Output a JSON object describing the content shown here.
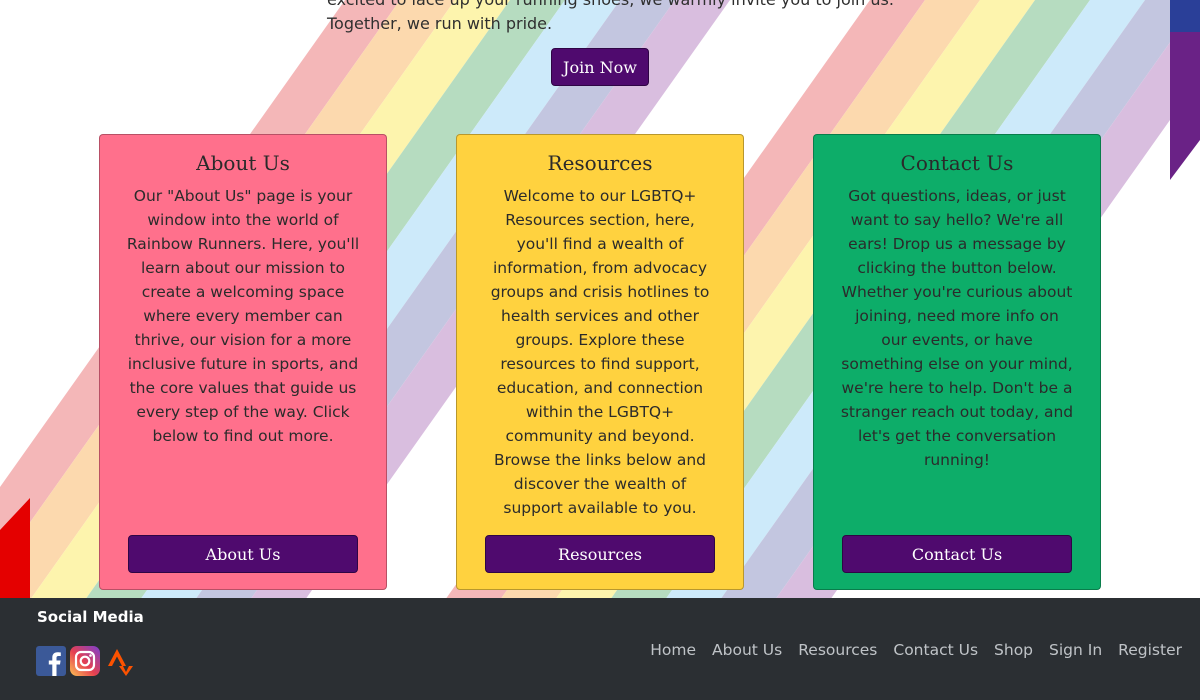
{
  "intro": {
    "line1": "excited to lace up your running shoes, we warmly invite you to join us.",
    "line2": "Together, we run with pride.",
    "join_label": "Join Now"
  },
  "colors": {
    "button": "#4f0a6e",
    "about_card": "#ff708c",
    "resources_card": "#ffd23f",
    "contact_card": "#0dad69",
    "footer": "#2b2f33"
  },
  "cards": [
    {
      "title": "About Us",
      "body": "Our \"About Us\" page is your window into the world of Rainbow Runners. Here, you'll learn about our mission to create a welcoming space where every member can thrive, our vision for a more inclusive future in sports, and the core values that guide us every step of the way. Click below to find out more.",
      "button": "About Us"
    },
    {
      "title": "Resources",
      "body": "Welcome to our LGBTQ+ Resources section, here, you'll find a wealth of information, from advocacy groups and crisis hotlines to health services and other groups. Explore these resources to find support, education, and connection within the LGBTQ+ community and beyond. Browse the links below and discover the wealth of support available to you.",
      "button": "Resources"
    },
    {
      "title": "Contact Us",
      "body": "Got questions, ideas, or just want to say hello? We're all ears! Drop us a message by clicking the button below. Whether you're curious about joining, need more info on our events, or have something else on your mind, we're here to help. Don't be a stranger reach out today, and let's get the conversation running!",
      "button": "Contact Us"
    }
  ],
  "footer": {
    "social_title": "Social Media",
    "social_icons": [
      "facebook-icon",
      "instagram-icon",
      "strava-icon"
    ],
    "nav": [
      "Home",
      "About Us",
      "Resources",
      "Contact Us",
      "Shop",
      "Sign In",
      "Register"
    ]
  }
}
